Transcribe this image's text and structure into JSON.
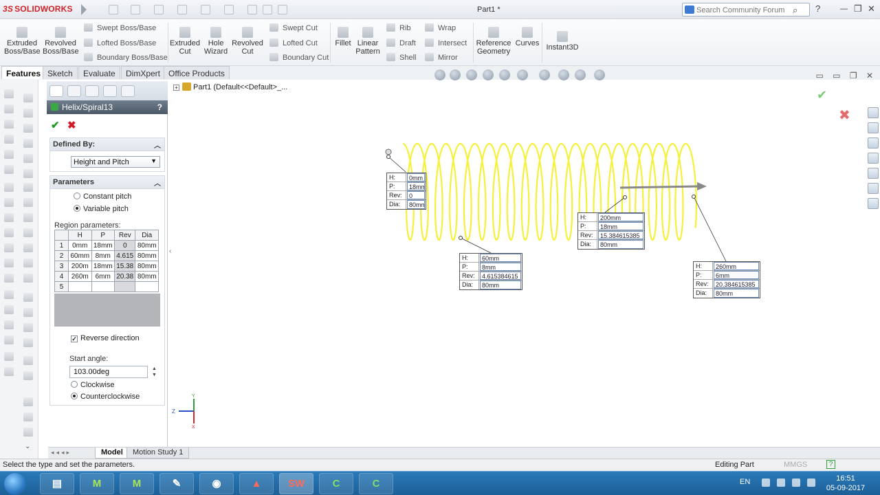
{
  "app": {
    "brand": "SOLIDWORKS",
    "brand_prefix": "3S",
    "document_title": "Part1 *"
  },
  "search": {
    "placeholder": "Search Community Forum"
  },
  "ribbon": {
    "big_buttons": [
      "Extruded Boss/Base",
      "Revolved Boss/Base",
      "Extruded Cut",
      "Hole Wizard",
      "Revolved Cut",
      "Fillet",
      "Linear Pattern",
      "Reference Geometry",
      "Curves",
      "Instant3D"
    ],
    "small_buttons": [
      "Swept Boss/Base",
      "Lofted Boss/Base",
      "Boundary Boss/Base",
      "Swept Cut",
      "Lofted Cut",
      "Boundary Cut",
      "Rib",
      "Draft",
      "Shell",
      "Wrap",
      "Intersect",
      "Mirror"
    ]
  },
  "command_tabs": [
    "Features",
    "Sketch",
    "Evaluate",
    "DimXpert",
    "Office Products"
  ],
  "feature_tree": {
    "root": "Part1  (Default<<Default>_..."
  },
  "property_manager": {
    "title": "Helix/Spiral13",
    "help": "?",
    "ok_icon": "✔",
    "cancel_icon": "✖",
    "defined_by": {
      "label": "Defined By:",
      "value": "Height and Pitch"
    },
    "parameters": {
      "label": "Parameters",
      "options": [
        "Constant pitch",
        "Variable pitch"
      ],
      "selected": "Variable pitch",
      "region_label": "Region parameters:",
      "table": {
        "headers": [
          "",
          "H",
          "P",
          "Rev",
          "Dia"
        ],
        "rows": [
          [
            "1",
            "0mm",
            "18mm",
            "0",
            "80mm"
          ],
          [
            "2",
            "60mm",
            "8mm",
            "4.615",
            "80mm"
          ],
          [
            "3",
            "200m",
            "18mm",
            "15.38",
            "80mm"
          ],
          [
            "4",
            "260m",
            "6mm",
            "20.38",
            "80mm"
          ],
          [
            "5",
            "",
            "",
            "",
            ""
          ]
        ]
      },
      "reverse_direction": {
        "label": "Reverse direction",
        "checked": true
      },
      "start_angle": {
        "label": "Start angle:",
        "value": "103.00deg"
      },
      "direction_options": [
        "Clockwise",
        "Counterclockwise"
      ],
      "direction_selected": "Counterclockwise"
    }
  },
  "callouts": [
    {
      "H": "0mm",
      "P": "18mm",
      "Rev": "0",
      "Dia": "80mm"
    },
    {
      "H": "60mm",
      "P": "8mm",
      "Rev": "4.615384615",
      "Dia": "80mm"
    },
    {
      "H": "200mm",
      "P": "18mm",
      "Rev": "15.384615385",
      "Dia": "80mm"
    },
    {
      "H": "260mm",
      "P": "6mm",
      "Rev": "20.384615385",
      "Dia": "80mm"
    }
  ],
  "callout_keys": {
    "h": "H:",
    "p": "P:",
    "rev": "Rev:",
    "dia": "Dia:"
  },
  "helix_color": "#f5f03a",
  "triad_labels": {
    "x": "X",
    "y": "Y",
    "z": "Z"
  },
  "bottom_tabs": [
    "Model",
    "Motion Study 1"
  ],
  "status": {
    "message": "Select the type and set the parameters.",
    "mode": "Editing Part",
    "units": "MMGS"
  },
  "taskbar": {
    "language": "EN",
    "time": "16:51",
    "date": "05-09-2017",
    "apps": [
      "explorer",
      "mcad-1",
      "mcad-2",
      "paint",
      "chrome",
      "acrobat",
      "solidworks",
      "camtasia-1",
      "camtasia-2"
    ]
  }
}
